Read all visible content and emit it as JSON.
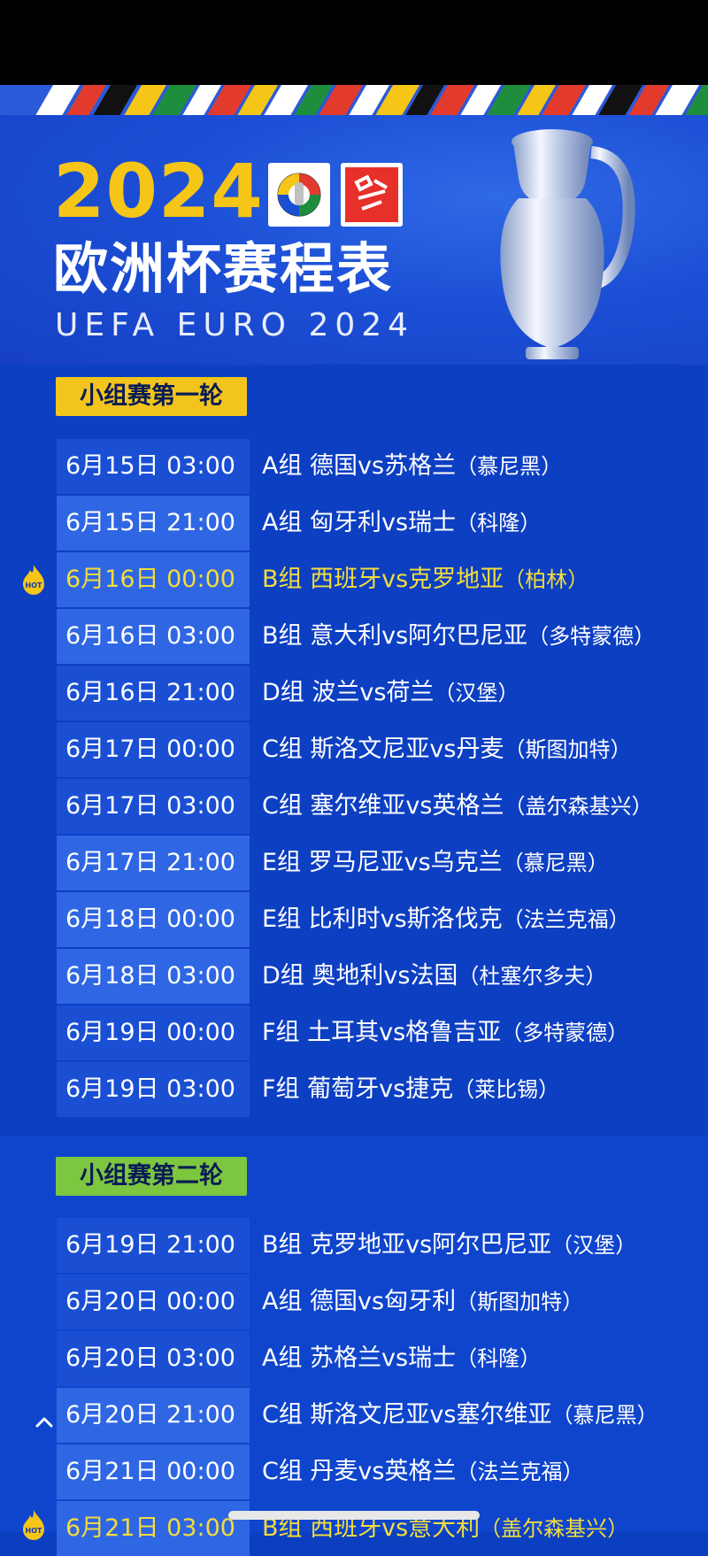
{
  "header": {
    "year": "2024",
    "title_cn": "欧洲杯赛程表",
    "title_en": "UEFA EURO 2024"
  },
  "rounds": [
    {
      "label": "小组赛第一轮",
      "matches": [
        {
          "date": "6月15日 03:00",
          "info": "A组 德国vs苏格兰",
          "venue": "（慕尼黑）"
        },
        {
          "date": "6月15日 21:00",
          "info": "A组 匈牙利vs瑞士",
          "venue": "（科隆）"
        },
        {
          "date": "6月16日 00:00",
          "info": "B组 西班牙vs克罗地亚",
          "venue": "（柏林）"
        },
        {
          "date": "6月16日 03:00",
          "info": "B组 意大利vs阿尔巴尼亚",
          "venue": "（多特蒙德）"
        },
        {
          "date": "6月16日 21:00",
          "info": "D组 波兰vs荷兰",
          "venue": "（汉堡）"
        },
        {
          "date": "6月17日 00:00",
          "info": "C组 斯洛文尼亚vs丹麦",
          "venue": "（斯图加特）"
        },
        {
          "date": "6月17日 03:00",
          "info": "C组 塞尔维亚vs英格兰",
          "venue": "（盖尔森基兴）"
        },
        {
          "date": "6月17日 21:00",
          "info": "E组 罗马尼亚vs乌克兰",
          "venue": "（慕尼黑）"
        },
        {
          "date": "6月18日 00:00",
          "info": "E组 比利时vs斯洛伐克",
          "venue": "（法兰克福）"
        },
        {
          "date": "6月18日 03:00",
          "info": "D组 奥地利vs法国",
          "venue": "（杜塞尔多夫）"
        },
        {
          "date": "6月19日 00:00",
          "info": "F组 土耳其vs格鲁吉亚",
          "venue": "（多特蒙德）"
        },
        {
          "date": "6月19日 03:00",
          "info": "F组 葡萄牙vs捷克",
          "venue": "（莱比锡）"
        }
      ]
    },
    {
      "label": "小组赛第二轮",
      "matches": [
        {
          "date": "6月19日 21:00",
          "info": "B组 克罗地亚vs阿尔巴尼亚",
          "venue": "（汉堡）"
        },
        {
          "date": "6月20日 00:00",
          "info": "A组 德国vs匈牙利",
          "venue": "（斯图加特）"
        },
        {
          "date": "6月20日 03:00",
          "info": "A组 苏格兰vs瑞士",
          "venue": "（科隆）"
        },
        {
          "date": "6月20日 21:00",
          "info": "C组 斯洛文尼亚vs塞尔维亚",
          "venue": "（慕尼黑）"
        },
        {
          "date": "6月21日 00:00",
          "info": "C组 丹麦vs英格兰",
          "venue": "（法兰克福）"
        },
        {
          "date": "6月21日 03:00",
          "info": "B组 西班牙vs意大利",
          "venue": "（盖尔森基兴）"
        }
      ]
    }
  ],
  "hot_label": "HOT",
  "colors": {
    "background": "#0d3fc2",
    "year": "#f5c518",
    "hot_text": "#f3dc3c",
    "round1_badge": "#f3c51c",
    "round2_badge": "#7dc63f"
  }
}
